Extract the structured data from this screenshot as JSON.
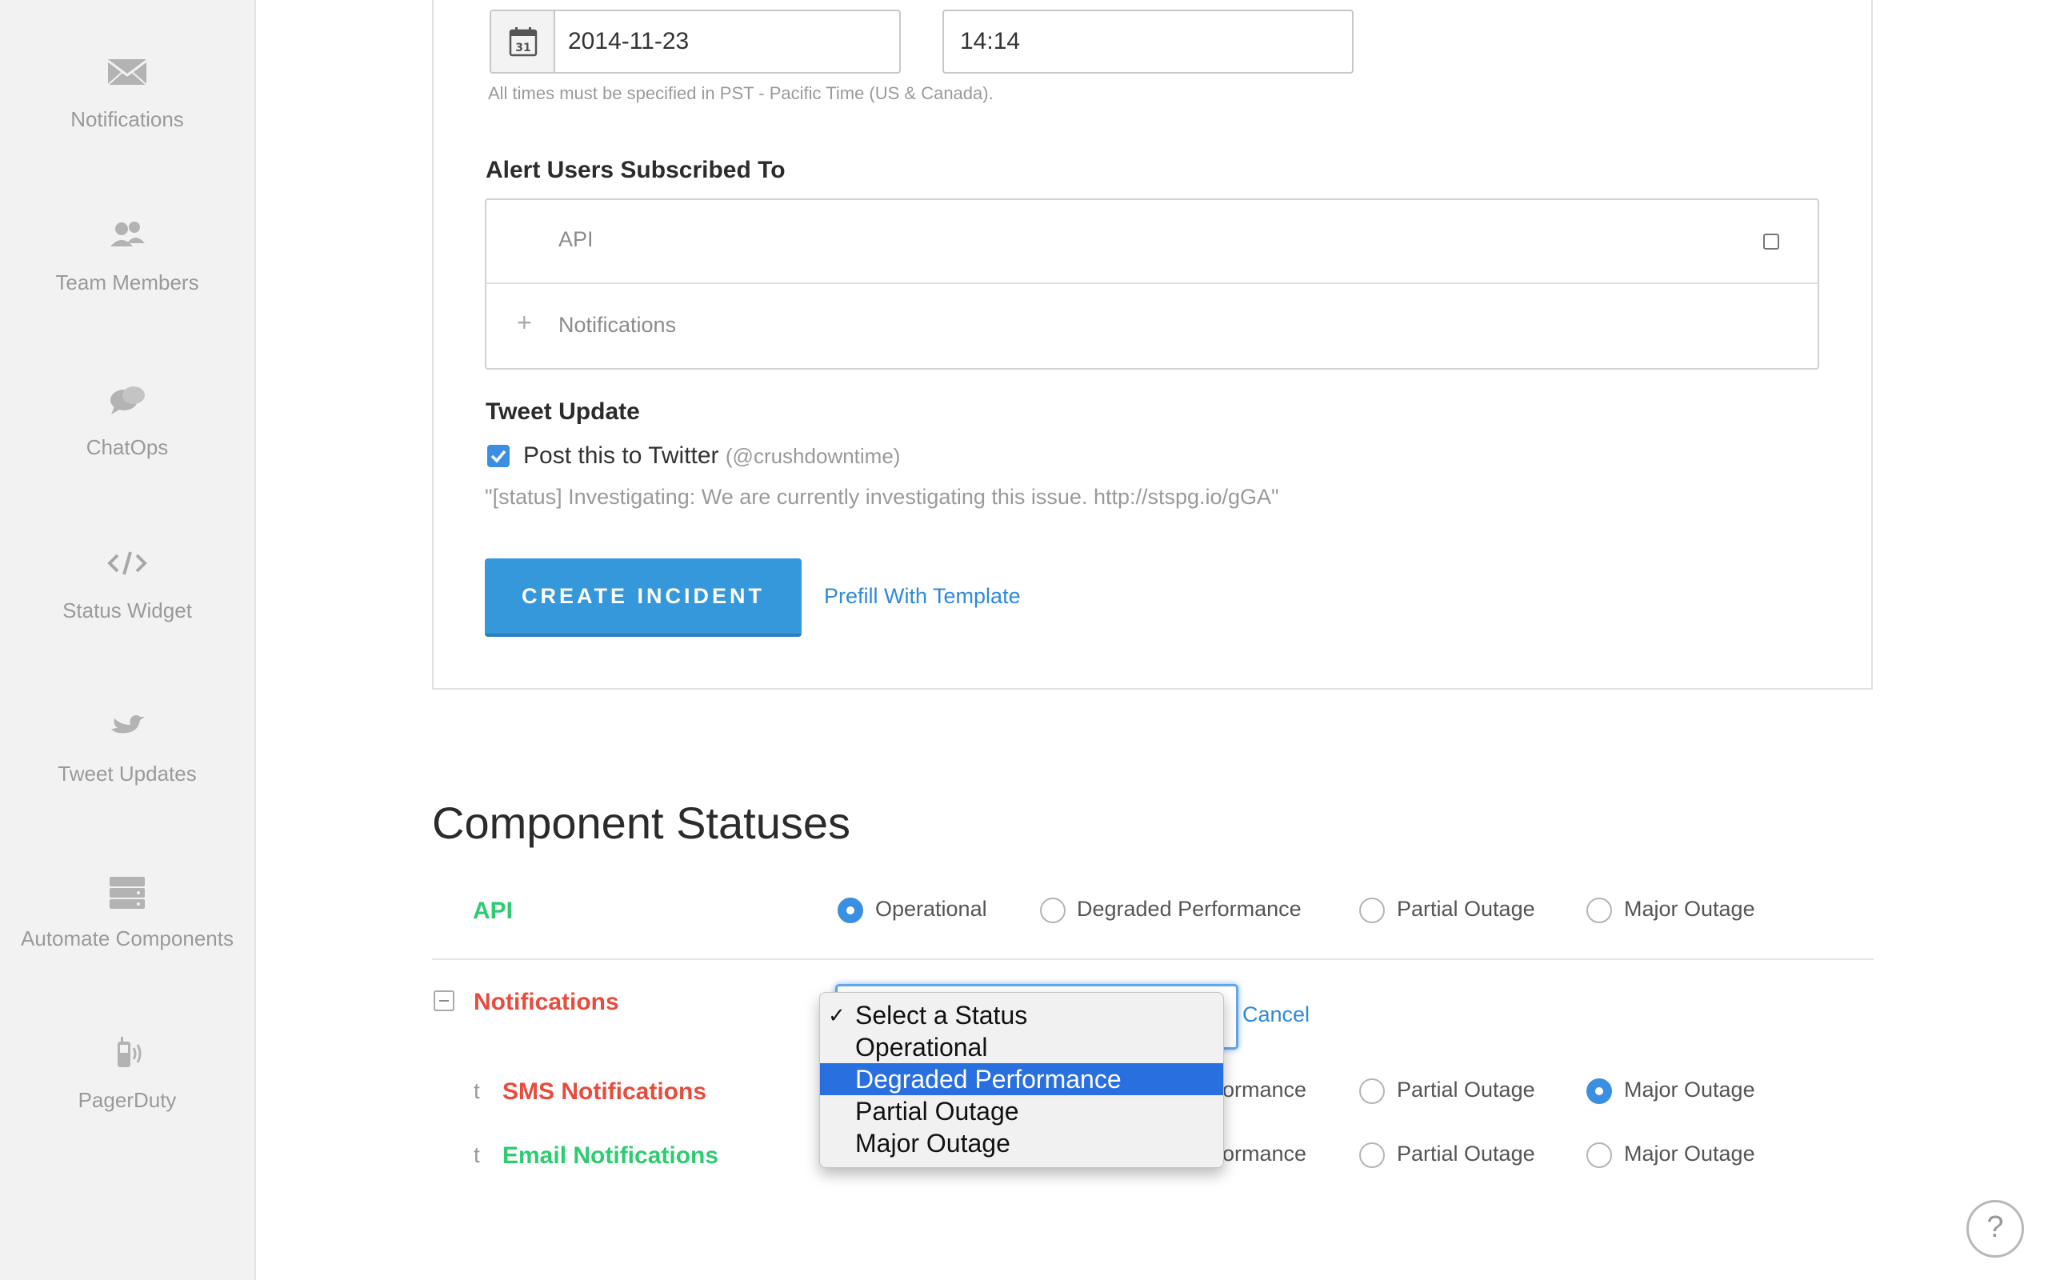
{
  "sidebar": {
    "items": [
      {
        "label": "Notifications",
        "icon": "envelope-icon"
      },
      {
        "label": "Team Members",
        "icon": "users-icon"
      },
      {
        "label": "ChatOps",
        "icon": "chat-bubbles-icon"
      },
      {
        "label": "Status Widget",
        "icon": "code-icon"
      },
      {
        "label": "Tweet Updates",
        "icon": "bird-icon"
      },
      {
        "label": "Automate Components",
        "icon": "server-icon"
      },
      {
        "label": "PagerDuty",
        "icon": "phone-signal-icon"
      }
    ]
  },
  "schedule": {
    "date_value": "2014-11-23",
    "time_value": "14:14",
    "calendar_day": "31",
    "timezone_note": "All times must be specified in PST - Pacific Time (US & Canada)."
  },
  "alert_users": {
    "title": "Alert Users Subscribed To",
    "rows": [
      {
        "label": "API"
      },
      {
        "label": "Notifications"
      }
    ]
  },
  "tweet": {
    "title": "Tweet Update",
    "checkbox_label": "Post this to Twitter",
    "handle": "(@crushdowntime)",
    "preview": "\"[status] Investigating: We are currently investigating this issue. http://stspg.io/gGA\""
  },
  "actions": {
    "create_label": "CREATE INCIDENT",
    "prefill_label": "Prefill With Template"
  },
  "components": {
    "title": "Component Statuses",
    "status_options": [
      "Operational",
      "Degraded Performance",
      "Partial Outage",
      "Major Outage"
    ],
    "api": {
      "name": "API",
      "selected": "Operational"
    },
    "notifications": {
      "name": "Notifications",
      "cancel_label": "Cancel"
    },
    "sms": {
      "name": "SMS Notifications",
      "selected": "Major Outage"
    },
    "email": {
      "name": "Email Notifications",
      "selected": "none"
    },
    "child_marker": "t",
    "partial_text": "ormance",
    "dropdown": {
      "options": [
        "Select a Status",
        "Operational",
        "Degraded Performance",
        "Partial Outage",
        "Major Outage"
      ],
      "checked": "Select a Status",
      "highlighted": "Degraded Performance",
      "check_mark": "✓"
    }
  },
  "help": {
    "label": "?"
  },
  "colors": {
    "accent": "#3498db",
    "operational": "#2ecc71",
    "outage": "#e74c3c",
    "link": "#2f8ad8"
  }
}
